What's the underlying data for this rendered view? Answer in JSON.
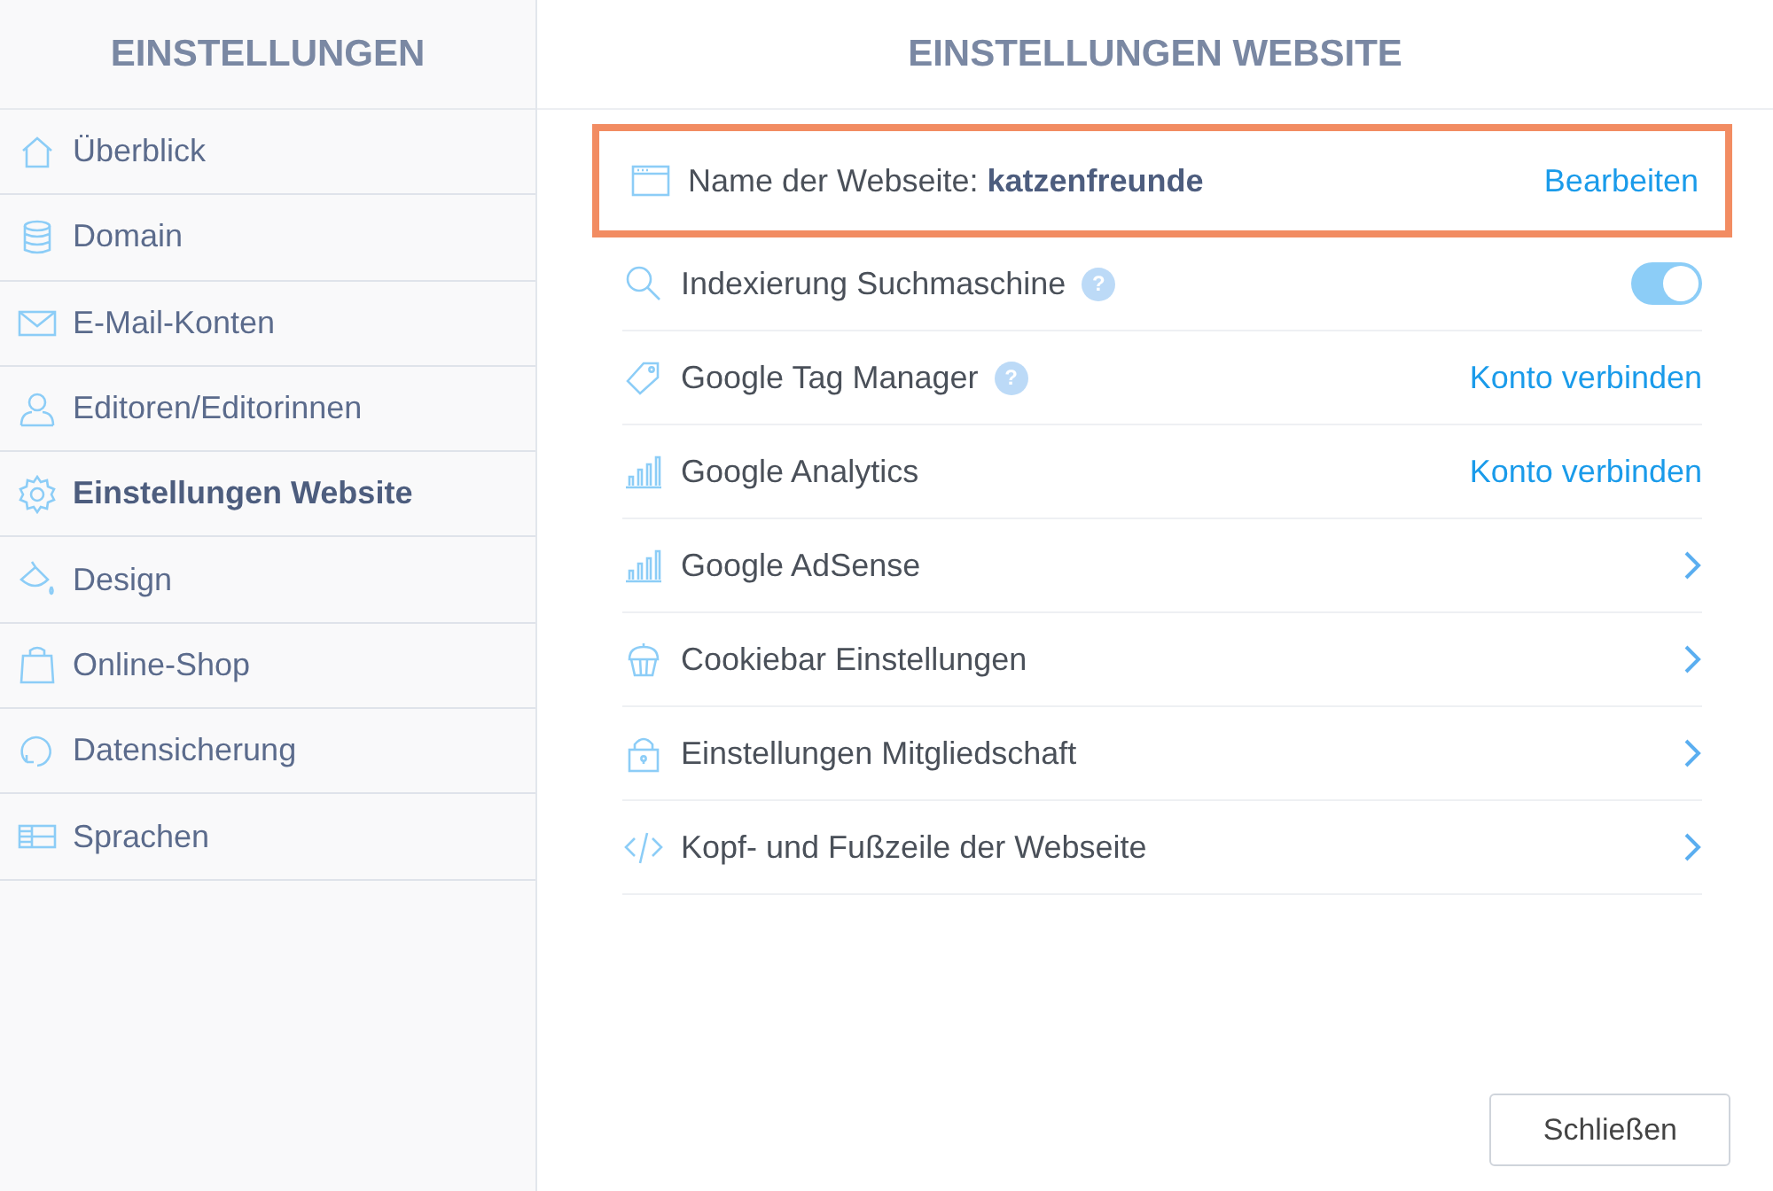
{
  "sidebar": {
    "title": "EINSTELLUNGEN",
    "items": [
      {
        "label": "Überblick",
        "selected": false
      },
      {
        "label": "Domain",
        "selected": false
      },
      {
        "label": "E-Mail-Konten",
        "selected": false
      },
      {
        "label": "Editoren/Editorinnen",
        "selected": false
      },
      {
        "label": "Einstellungen Website",
        "selected": true
      },
      {
        "label": "Design",
        "selected": false
      },
      {
        "label": "Online-Shop",
        "selected": false
      },
      {
        "label": "Datensicherung",
        "selected": false
      },
      {
        "label": "Sprachen",
        "selected": false
      }
    ]
  },
  "main": {
    "title": "EINSTELLUNGEN WEBSITE",
    "rows": [
      {
        "kind": "link",
        "label": "Name der Webseite: **katzenfreunde**",
        "action": "Bearbeiten",
        "highlighted": true
      },
      {
        "kind": "toggle",
        "label": "Indexierung Suchmaschine",
        "help": "?",
        "on": true,
        "highlighted": false
      },
      {
        "kind": "link",
        "label": "Google Tag Manager",
        "help": "?",
        "action": "Konto verbinden",
        "highlighted": false
      },
      {
        "kind": "link",
        "label": "Google Analytics",
        "action": "Konto verbinden",
        "highlighted": false
      },
      {
        "kind": "chevron",
        "label": "Google AdSense",
        "highlighted": false
      },
      {
        "kind": "chevron",
        "label": "Cookiebar Einstellungen",
        "highlighted": false
      },
      {
        "kind": "chevron",
        "label": "Einstellungen Mitgliedschaft",
        "highlighted": false
      },
      {
        "kind": "chevron",
        "label": "Kopf- und Fußzeile der Webseite",
        "highlighted": false
      }
    ],
    "close_button": "Schließen"
  }
}
